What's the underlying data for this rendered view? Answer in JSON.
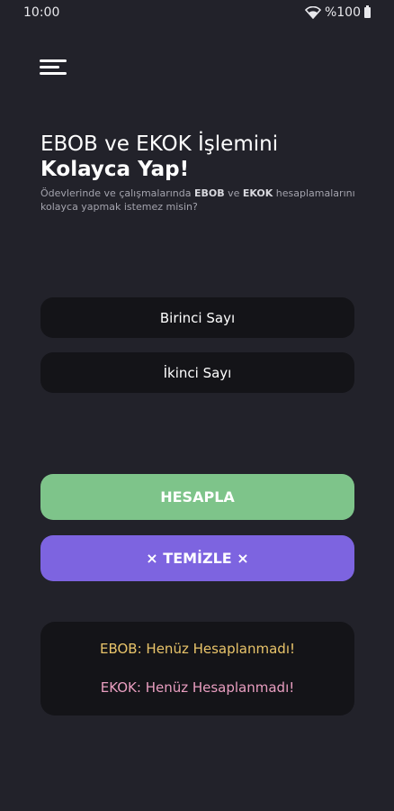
{
  "status_bar": {
    "time": "10:00",
    "battery": "%100"
  },
  "header": {
    "line1": "EBOB ve EKOK İşlemini",
    "line2": "Kolayca Yap!",
    "sub_part1": "Ödevlerinde ve çalışmalarında ",
    "sub_ebob": "EBOB",
    "sub_part2": " ve ",
    "sub_ekok": "EKOK",
    "sub_part3": " hesaplamalarını kolayca yapmak istemez misin?"
  },
  "inputs": {
    "first_placeholder": "Birinci Sayı",
    "second_placeholder": "İkinci Sayı"
  },
  "buttons": {
    "calculate": "HESAPLA",
    "clear": "× TEMİZLE ×"
  },
  "results": {
    "ebob": "EBOB: Henüz Hesaplanmadı!",
    "ekok": "EKOK: Henüz Hesaplanmadı!"
  },
  "colors": {
    "background": "#22222a",
    "calculate_button": "#7ec48a",
    "clear_button": "#7d64e0",
    "ebob_text": "#e9c46a",
    "ekok_text": "#e99ec0"
  }
}
